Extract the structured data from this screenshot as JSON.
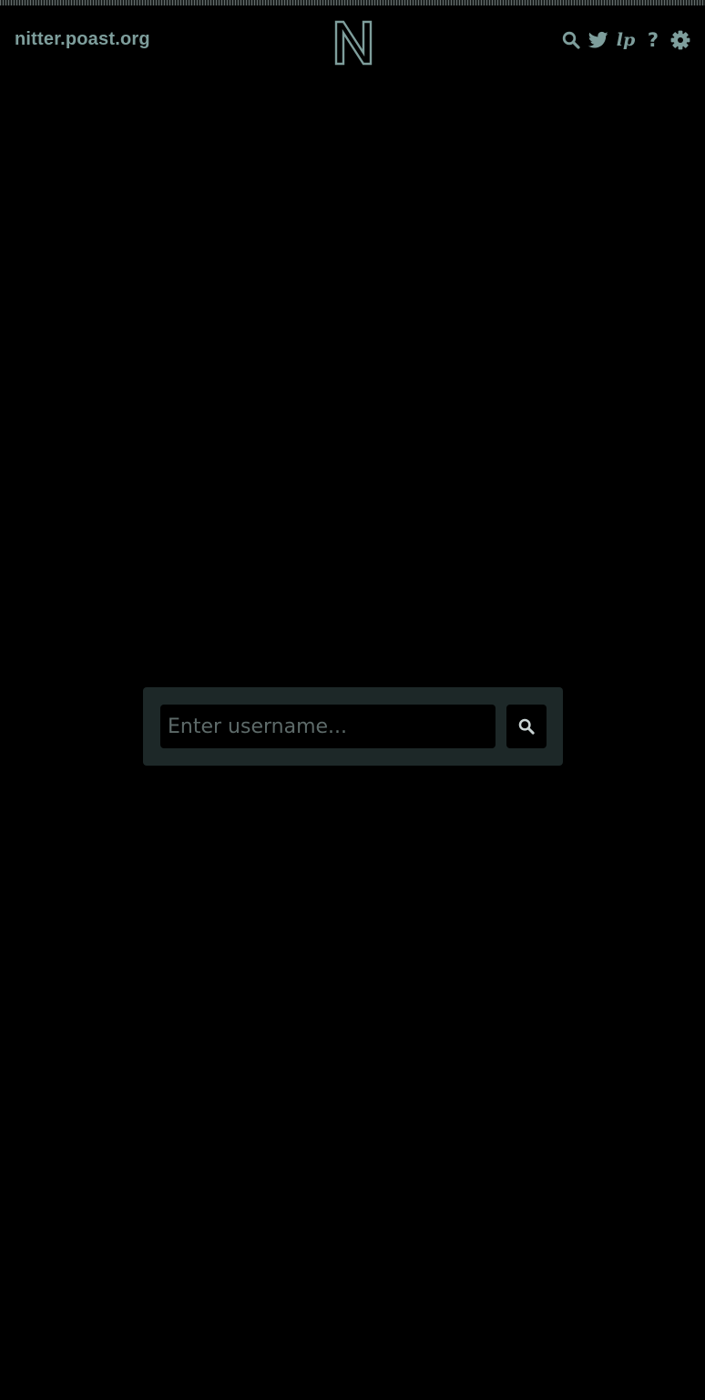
{
  "header": {
    "site_name": "nitter.poast.org",
    "logo_icon": "nitter-n-logo-icon",
    "nav_icons": [
      "search-icon",
      "twitter-bird-icon",
      "lp-icon",
      "help-icon",
      "gear-icon"
    ],
    "lp_glyph": "lp",
    "help_glyph": "?"
  },
  "search": {
    "placeholder": "Enter username...",
    "value": "",
    "button_icon": "search-icon"
  },
  "colors": {
    "background": "#000000",
    "accent": "#7e9e9c",
    "panel": "#1d2828",
    "placeholder": "#5d6a69"
  }
}
